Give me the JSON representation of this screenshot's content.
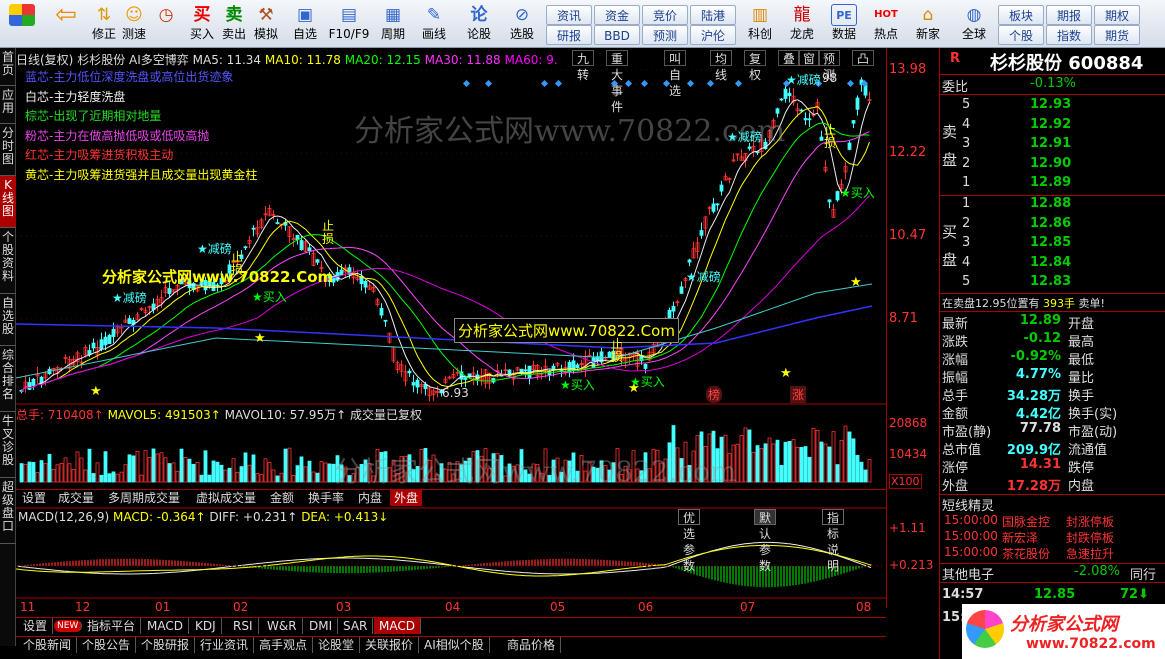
{
  "toolbar": {
    "items": [
      {
        "label": "",
        "icon": "home-grid-icon"
      },
      {
        "label": "",
        "icon": "back-arrow-icon"
      },
      {
        "label": "修正",
        "icon": "up-down-arrows-icon"
      },
      {
        "label": "测速",
        "icon": "smiley-icon"
      },
      {
        "label": "",
        "icon": "clock-icon"
      },
      {
        "label": "买入",
        "icon": "buy-icon",
        "glyph": "买"
      },
      {
        "label": "卖出",
        "icon": "sell-icon",
        "glyph": "卖"
      },
      {
        "label": "模拟",
        "icon": "hammer-icon"
      },
      {
        "label": "自选",
        "icon": "star-folder-icon"
      },
      {
        "label": "F10/F9",
        "icon": "document-icon"
      },
      {
        "label": "周期",
        "icon": "grid-icon"
      },
      {
        "label": "画线",
        "icon": "pen-icon"
      },
      {
        "label": "论股",
        "icon": "speech-icon",
        "glyph": "论"
      },
      {
        "label": "选股",
        "icon": "search-chart-icon"
      },
      {
        "label": "科创",
        "icon": "chart-screen-icon"
      },
      {
        "label": "龙虎",
        "icon": "dragon-icon"
      },
      {
        "label": "数据",
        "icon": "pe-icon",
        "glyph": "PE"
      },
      {
        "label": "热点",
        "icon": "hot-icon",
        "glyph": "HOT"
      },
      {
        "label": "新家",
        "icon": "new-home-icon"
      },
      {
        "label": "全球",
        "icon": "globe-icon"
      }
    ],
    "mini": [
      "资讯",
      "资金",
      "竞价",
      "陆港",
      "研报",
      "BBD",
      "预测",
      "沪伦"
    ],
    "mini2": [
      "板块",
      "期报",
      "期权",
      "个股",
      "指数",
      "期货"
    ]
  },
  "sidebar": [
    "首页",
    "应用",
    "分时图",
    "K线图",
    "个股资料",
    "自选股",
    "综合排名",
    "牛叉诊股",
    "超级盘口"
  ],
  "chart": {
    "header": {
      "period": "日线(复权)",
      "stock": "杉杉股份",
      "ai": "AI多空博弈",
      "ma5": "MA5: 11.34",
      "ma10": "MA10: 11.78",
      "ma20": "MA20: 12.15",
      "ma30": "MA30: 11.88",
      "ma60": "MA60: 9."
    },
    "header_tools": [
      "九转",
      "重大事件",
      "叫自选",
      "均线",
      "复权",
      "叠",
      "窗",
      "预测",
      "凸"
    ],
    "legend": [
      {
        "text": "蓝芯-主力低位深度洗盘或高位出货迹象",
        "color": "#55f"
      },
      {
        "text": "白芯-主力轻度洗盘",
        "color": "#eee"
      },
      {
        "text": "棕芯-出现了近期相对地量",
        "color": "#2d2"
      },
      {
        "text": "粉芯-主力在做高抛低吸或低吸高抛",
        "color": "#e4e"
      },
      {
        "text": "红芯-主力吸筹进货积极主动",
        "color": "#f33"
      },
      {
        "text": "黄芯-主力吸筹进货强并且成交量出现黄金柱",
        "color": "#ff0"
      }
    ],
    "price_axis": [
      "13.98",
      "12.22",
      "10.47",
      "8.71"
    ],
    "annotations": {
      "jianchou": "减磅",
      "mairu": "买入",
      "zhisun": "止损",
      "high_label": "98",
      "low_label": "6.93",
      "bang": "榜",
      "zhang": "涨"
    },
    "watermark1": "分析家公式网www.70822.com",
    "watermark2": "分析家公式网www.70822.Com",
    "watermark3": "分析家公式网www.70822.Com",
    "volume": {
      "label": "总手: 710408↑",
      "mavol5": "MAVOL5: 491503↑",
      "mavol10": "MAVOL10: 57.95万↑",
      "note": "成交量已复权",
      "axis": [
        "20868",
        "10434"
      ],
      "scale": "X100"
    },
    "vol_tabs": [
      "设置",
      "成交量",
      "多周期成交量",
      "虚拟成交量",
      "金额",
      "换手率",
      "内盘",
      "外盘"
    ],
    "macd": {
      "label": "MACD(12,26,9)",
      "macd": "MACD: -0.364↑",
      "diff": "DIFF: +0.231↑",
      "dea": "DEA: +0.413↓",
      "axis": [
        "+1.11",
        "+0.213"
      ],
      "tabs": [
        "优选参数",
        "默认参数",
        "指标说明"
      ]
    },
    "months": [
      "11",
      "12",
      "01",
      "02",
      "03",
      "04",
      "05",
      "06",
      "07",
      "08"
    ],
    "bottom_tabs": [
      "设置",
      "NEW",
      "指标平台",
      "MACD",
      "KDJ",
      "RSI",
      "W&R",
      "DMI",
      "SAR",
      "MACD"
    ],
    "news_tabs": [
      "个股新闻",
      "个股公告",
      "个股研报",
      "行业资讯",
      "高手观点",
      "论股堂",
      "关联报价",
      "AI相似个股",
      "商品价格"
    ]
  },
  "quote": {
    "name": "杉杉股份",
    "code": "600884",
    "weibi_label": "委比",
    "weibi": "-0.13%",
    "sell_label": "卖盘",
    "buy_label": "买盘",
    "asks": [
      {
        "n": "5",
        "p": "12.93"
      },
      {
        "n": "4",
        "p": "12.92"
      },
      {
        "n": "3",
        "p": "12.91"
      },
      {
        "n": "2",
        "p": "12.90"
      },
      {
        "n": "1",
        "p": "12.89"
      }
    ],
    "bids": [
      {
        "n": "1",
        "p": "12.88"
      },
      {
        "n": "2",
        "p": "12.86"
      },
      {
        "n": "3",
        "p": "12.85"
      },
      {
        "n": "4",
        "p": "12.84"
      },
      {
        "n": "5",
        "p": "12.83"
      }
    ],
    "sellwall": "在卖盘12.95位置有",
    "sellwall_vol": "393手",
    "sellwall_tag": "卖单!",
    "stats": [
      {
        "l": "最新",
        "v": "12.89",
        "c": "grn",
        "r": "开盘"
      },
      {
        "l": "涨跌",
        "v": "-0.12",
        "c": "grn",
        "r": "最高"
      },
      {
        "l": "涨幅",
        "v": "-0.92%",
        "c": "grn",
        "r": "最低"
      },
      {
        "l": "振幅",
        "v": "4.77%",
        "c": "cyan",
        "r": "量比"
      },
      {
        "l": "总手",
        "v": "34.28万",
        "c": "cyan",
        "r": "换手"
      },
      {
        "l": "金额",
        "v": "4.42亿",
        "c": "cyan",
        "r": "换手(实)"
      },
      {
        "l": "市盈(静)",
        "v": "77.78",
        "c": "wht",
        "r": "市盈(动)"
      },
      {
        "l": "总市值",
        "v": "209.9亿",
        "c": "cyan",
        "r": "流通值"
      },
      {
        "l": "涨停",
        "v": "14.31",
        "c": "red",
        "r": "跌停"
      },
      {
        "l": "外盘",
        "v": "17.28万",
        "c": "red",
        "r": "内盘"
      }
    ],
    "sprite_title": "短线精灵",
    "sprite": [
      {
        "t": "15:00:00",
        "s": "国脉金控",
        "e": "封涨停板"
      },
      {
        "t": "15:00:00",
        "s": "新宏泽",
        "e": "封跌停板"
      },
      {
        "t": "15:00:00",
        "s": "茶花股份",
        "e": "急速拉升"
      }
    ],
    "other": "其他电子",
    "other_pct": "-2.08%",
    "other_tag": "同行",
    "tick_time": "14:57",
    "tick_price": "12.85",
    "tick_vol": "72",
    "tick_time2": "15:",
    "logo_text": "分析家公式网",
    "logo_url": "www.70822.com"
  }
}
